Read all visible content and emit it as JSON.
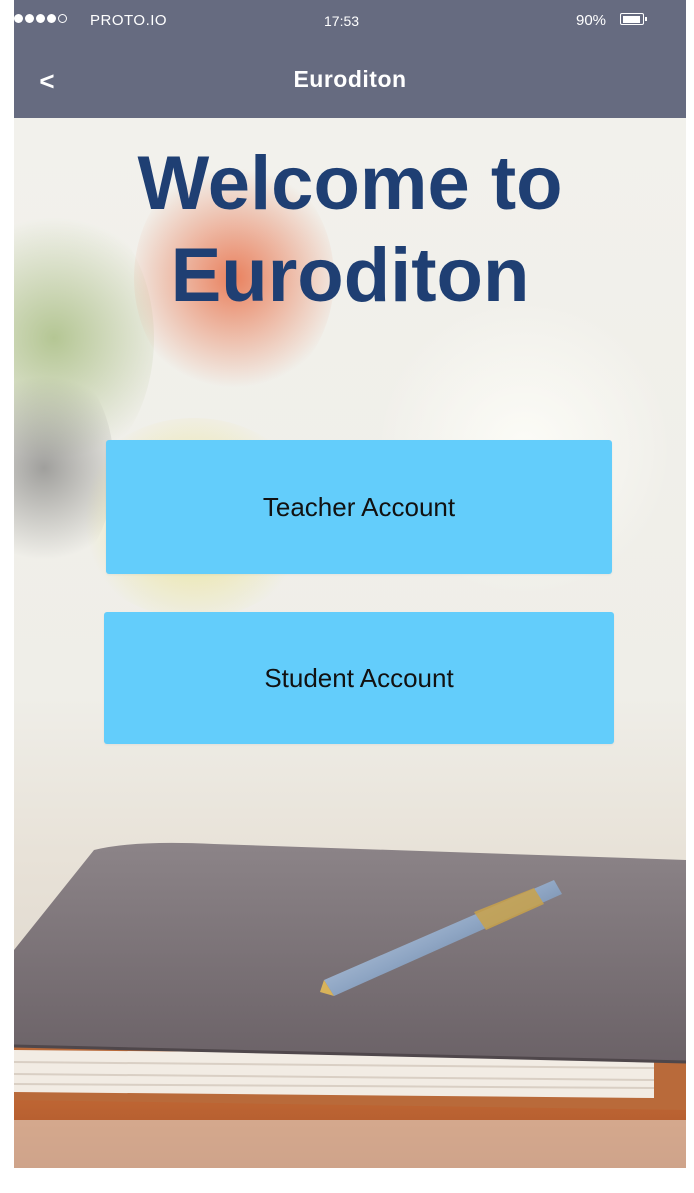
{
  "status_bar": {
    "carrier": "PROTO.IO",
    "time": "17:53",
    "battery_percent": "90%",
    "battery_level": 0.9,
    "signal_bars_filled": 4,
    "signal_bars_total": 5
  },
  "nav_bar": {
    "back_icon": "chevron-left-icon",
    "back_glyph": "<",
    "title": "Euroditon"
  },
  "main": {
    "title_line1": "Welcome to",
    "title_line2": "Euroditon",
    "teacher_button": "Teacher Account",
    "student_button": "Student Account"
  },
  "colors": {
    "bar": "#666b80",
    "title": "#1f3f73",
    "button": "#63cdfb"
  }
}
